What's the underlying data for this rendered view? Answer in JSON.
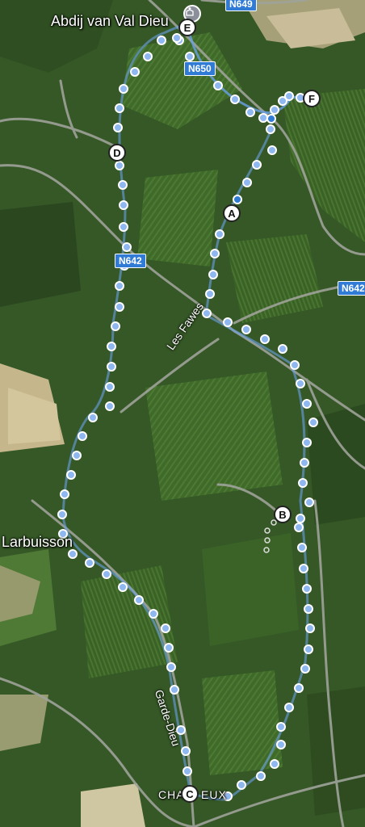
{
  "places": {
    "abbey": "Abdij van Val Dieu",
    "larbuisson": "Larbuisson",
    "chaineux_left": "CHA",
    "chaineux_right": "EUX"
  },
  "roads": {
    "fawes": "Les Fawes",
    "garde_dieu": "Garde-Dieu"
  },
  "shields": {
    "n649": "N649",
    "n650": "N650",
    "n642_center": "N642",
    "n642_right": "N642"
  },
  "waypoints": {
    "a": "A",
    "b": "B",
    "c": "C",
    "d": "D",
    "e": "E",
    "f": "F"
  },
  "icons": [
    "abbey-icon"
  ]
}
